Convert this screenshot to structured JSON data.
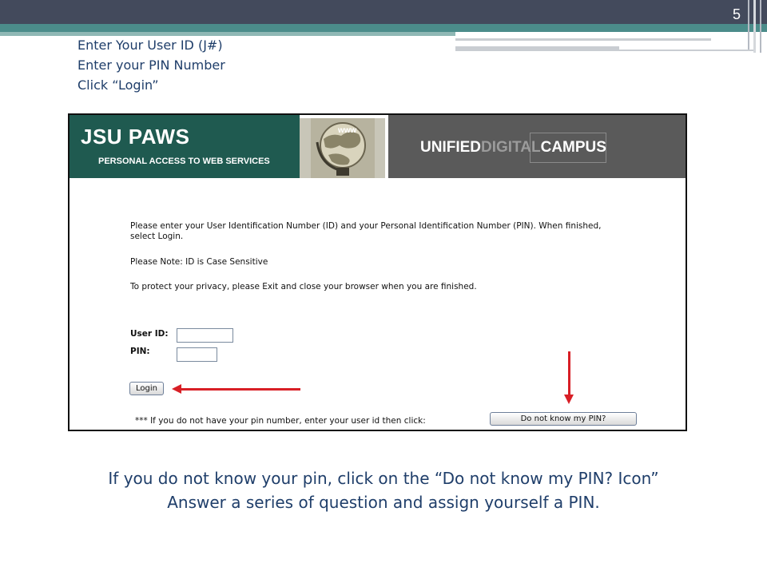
{
  "slide": {
    "number": "5",
    "intro_lines": [
      "Enter Your User ID (J#)",
      "Enter your PIN Number",
      "Click “Login”"
    ],
    "caption_lines": [
      "If you do not know your pin, click on the “Do not know my PIN? Icon”",
      "Answer a series of question and assign yourself a PIN."
    ]
  },
  "banner": {
    "title": "JSU PAWS",
    "subtitle": "PERSONAL ACCESS TO WEB SERVICES",
    "globe_label": "www",
    "right_logo_start": "UNIFIED",
    "right_logo_mid": "DIGITAL",
    "right_logo_end": "CAMPUS"
  },
  "login_page": {
    "instructions_1": "Please enter your User Identification Number (ID) and your Personal Identification Number (PIN). When finished,",
    "instructions_2": "select Login.",
    "note": "Please Note: ID is Case Sensitive",
    "privacy": "To protect your privacy, please Exit and close your browser when you are finished.",
    "user_id_label": "User ID:",
    "pin_label": "PIN:",
    "user_id_value": "",
    "pin_value": "",
    "login_button": "Login",
    "forgot_prompt": "*** If you do not have your pin number, enter your user id then click:",
    "forgot_button": "Do not know my PIN?"
  },
  "colors": {
    "slide_text": "#1f3e6a",
    "banner_green": "#1f5a50",
    "banner_gray": "#5a5a5a",
    "arrow_red": "#d81f26"
  }
}
